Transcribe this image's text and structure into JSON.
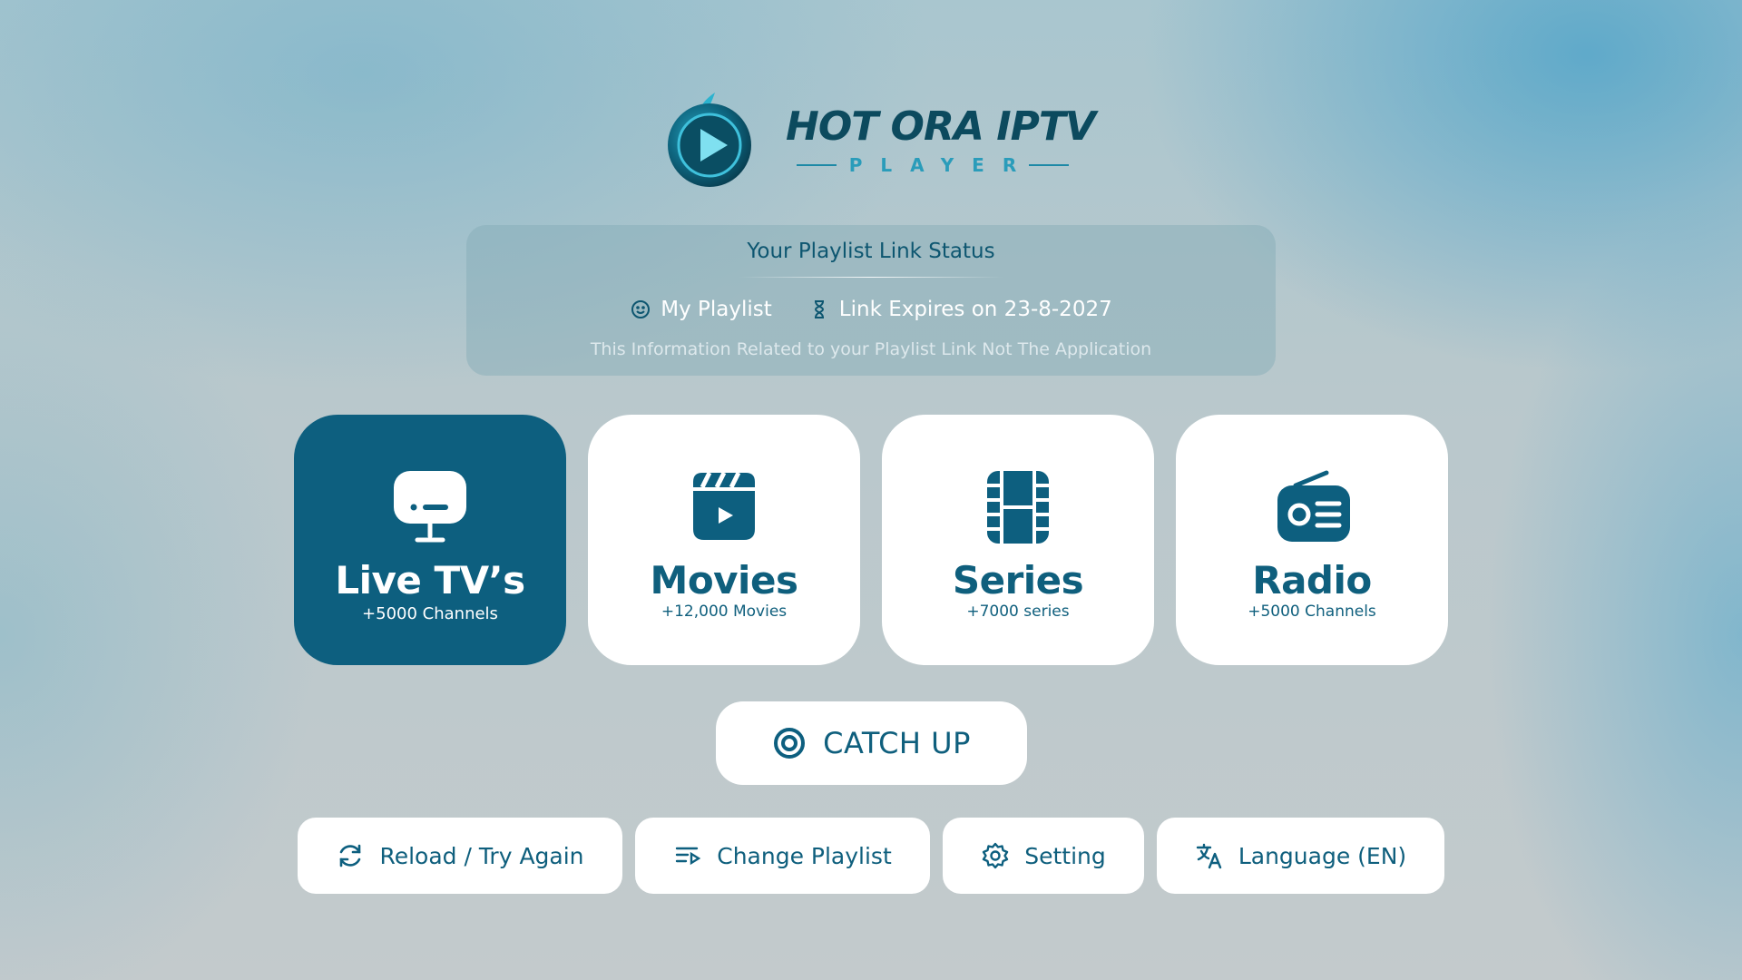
{
  "logo": {
    "title": "HOT ORA IPTV",
    "subtitle": "PLAYER"
  },
  "status": {
    "title": "Your Playlist Link Status",
    "playlist_name": "My Playlist",
    "expiry": "Link Expires on 23-8-2027",
    "note": "This Information Related to your Playlist Link Not The Application"
  },
  "categories": [
    {
      "title": "Live TV’s",
      "subtitle": "+5000 Channels",
      "icon": "tv-icon",
      "selected": true
    },
    {
      "title": "Movies",
      "subtitle": "+12,000 Movies",
      "icon": "clapperboard-icon",
      "selected": false
    },
    {
      "title": "Series",
      "subtitle": "+7000 series",
      "icon": "film-grid-icon",
      "selected": false
    },
    {
      "title": "Radio",
      "subtitle": "+5000 Channels",
      "icon": "radio-icon",
      "selected": false
    }
  ],
  "catchup": {
    "label": "CATCH UP",
    "icon": "target-icon"
  },
  "actions": [
    {
      "label": "Reload / Try Again",
      "icon": "refresh-icon"
    },
    {
      "label": "Change Playlist",
      "icon": "playlist-icon"
    },
    {
      "label": "Setting",
      "icon": "gear-icon"
    },
    {
      "label": "Language (EN)",
      "icon": "translate-icon"
    }
  ],
  "colors": {
    "primary": "#0d5f7f",
    "accent": "#2a9cba",
    "card_background": "#ffffff"
  }
}
